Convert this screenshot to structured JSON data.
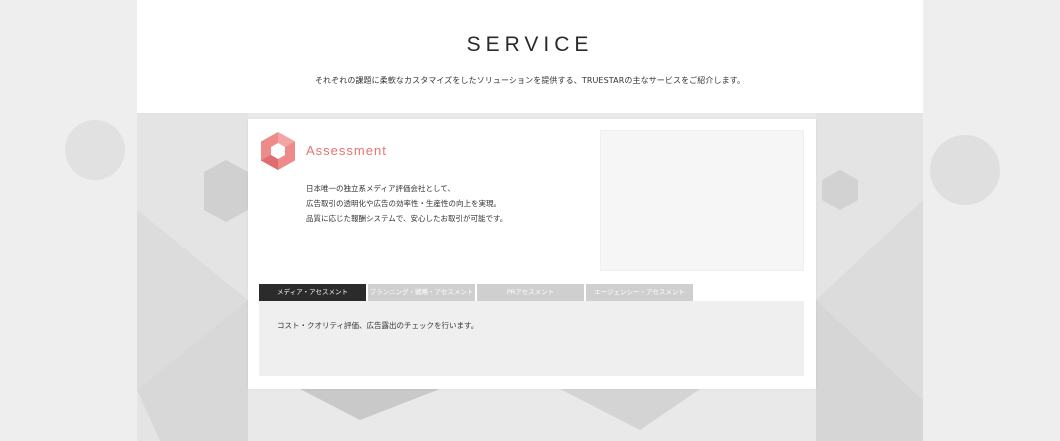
{
  "header": {
    "title": "SERVICE",
    "subtitle": "それぞれの課題に柔軟なカスタマイズをしたソリューションを提供する、TRUESTARの主なサービスをご紹介します。"
  },
  "service": {
    "name": "Assessment",
    "icon": "hexagon-logo-icon",
    "accent_color": "#e77272",
    "description": [
      "日本唯一の独立系メディア評価会社として、",
      "広告取引の透明化や広告の効率性・生産性の向上を実現。",
      "品質に応じた報酬システムで、安心したお取引が可能です。"
    ]
  },
  "tabs": [
    {
      "label": "メディア・アセスメント",
      "active": true
    },
    {
      "label": "プランニング・戦略・アセスメント",
      "active": false
    },
    {
      "label": "PRアセスメント",
      "active": false
    },
    {
      "label": "エージェンシー・アセスメント",
      "active": false
    }
  ],
  "tab_content": {
    "text": "コスト・クオリティ評価、広告露出のチェックを行います。"
  }
}
